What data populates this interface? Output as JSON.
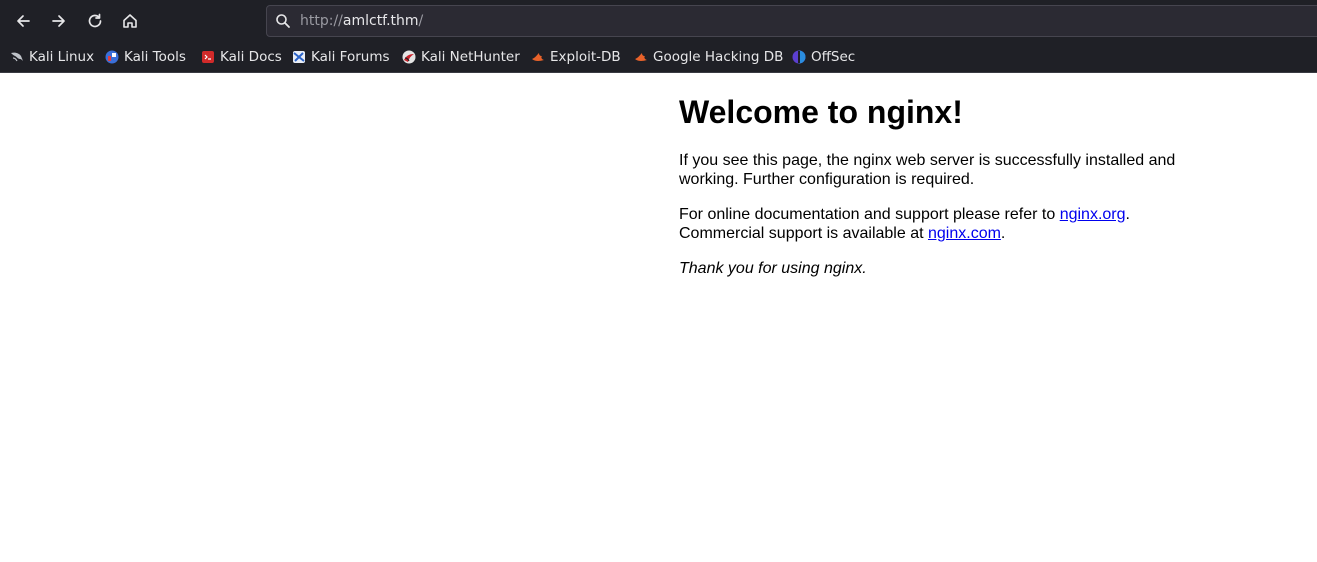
{
  "browser": {
    "url": {
      "protocol": "http://",
      "host": "amlctf.thm",
      "path": "/"
    },
    "bookmarks": [
      {
        "label": "Kali Linux",
        "icon": "kali-dragon-icon"
      },
      {
        "label": "Kali Tools",
        "icon": "kali-tools-icon"
      },
      {
        "label": "Kali Docs",
        "icon": "kali-docs-icon"
      },
      {
        "label": "Kali Forums",
        "icon": "kali-forums-icon"
      },
      {
        "label": "Kali NetHunter",
        "icon": "nethunter-icon"
      },
      {
        "label": "Exploit-DB",
        "icon": "exploit-db-icon"
      },
      {
        "label": "Google Hacking DB",
        "icon": "ghdb-icon"
      },
      {
        "label": "OffSec",
        "icon": "offsec-icon"
      }
    ],
    "colors": {
      "chrome_bg": "#1f2026",
      "urlbar_bg": "#2b2a33"
    }
  },
  "page": {
    "heading": "Welcome to nginx!",
    "p1": "If you see this page, the nginx web server is successfully installed and working. Further configuration is required.",
    "p2_prefix": "For online documentation and support please refer to ",
    "link1": "nginx.org",
    "p2_mid": ".",
    "p2_line2": "Commercial support is available at ",
    "link2": "nginx.com",
    "p2_suffix": ".",
    "p3": "Thank you for using nginx.",
    "colors": {
      "link": "#0000ee",
      "text": "#000000"
    }
  }
}
